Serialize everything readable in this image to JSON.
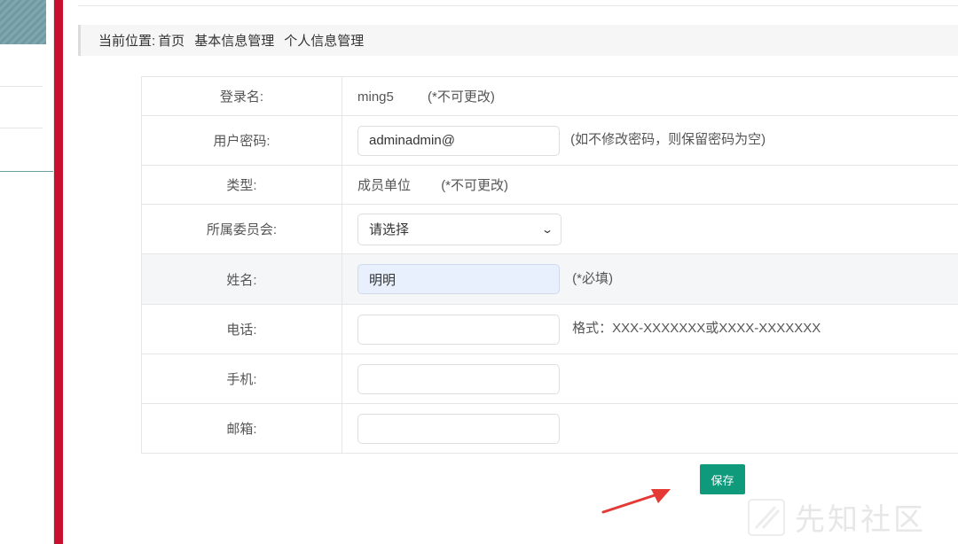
{
  "breadcrumb": {
    "label": "当前位置:",
    "items": [
      "首页",
      "基本信息管理",
      "个人信息管理"
    ]
  },
  "form": {
    "login": {
      "label": "登录名:",
      "value": "ming5",
      "note": "(*不可更改)"
    },
    "password": {
      "label": "用户密码:",
      "value": "adminadmin@",
      "note": "(如不修改密码，则保留密码为空)"
    },
    "type": {
      "label": "类型:",
      "value": "成员单位",
      "note": "(*不可更改)"
    },
    "committee": {
      "label": "所属委员会:",
      "selected": "请选择"
    },
    "name": {
      "label": "姓名:",
      "value": "明明",
      "note": "(*必填)"
    },
    "phone": {
      "label": "电话:",
      "value": "",
      "note": "格式：XXX-XXXXXXX或XXXX-XXXXXXX"
    },
    "mobile": {
      "label": "手机:",
      "value": ""
    },
    "email": {
      "label": "邮箱:",
      "value": ""
    }
  },
  "save_label": "保存",
  "watermark": "先知社区",
  "colors": {
    "accent_red": "#c8102e",
    "button_green": "#0f9a7c",
    "arrow_red": "#e53935"
  }
}
